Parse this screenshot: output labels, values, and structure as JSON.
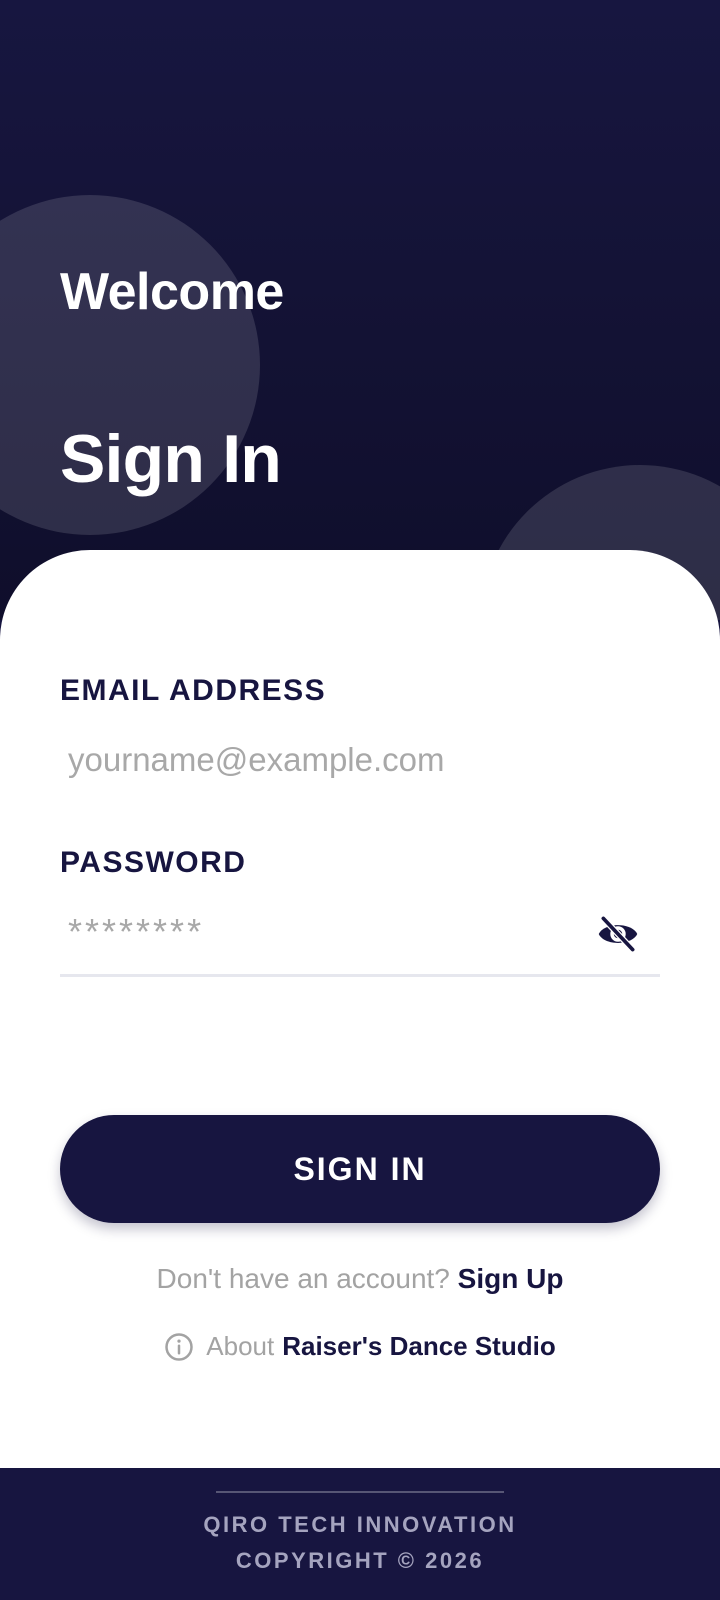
{
  "header": {
    "greeting": "Welcome",
    "title": "Sign In"
  },
  "form": {
    "email": {
      "label": "EMAIL ADDRESS",
      "placeholder": "yourname@example.com",
      "value": ""
    },
    "password": {
      "label": "PASSWORD",
      "placeholder": "********",
      "value": "",
      "toggle_icon": "eye-off-icon"
    },
    "submit_label": "SIGN IN"
  },
  "signup": {
    "prompt": "Don't have an account?",
    "link": "Sign Up"
  },
  "about": {
    "icon": "info-icon",
    "prefix": "About",
    "name": "Raiser's Dance Studio"
  },
  "footer": {
    "company": "QIRO TECH INNOVATION",
    "copyright": "COPYRIGHT © 2026"
  },
  "colors": {
    "primary": "#171540",
    "background_card": "#ffffff",
    "muted_text": "#a3a3a3",
    "placeholder": "#a8a8a8"
  }
}
